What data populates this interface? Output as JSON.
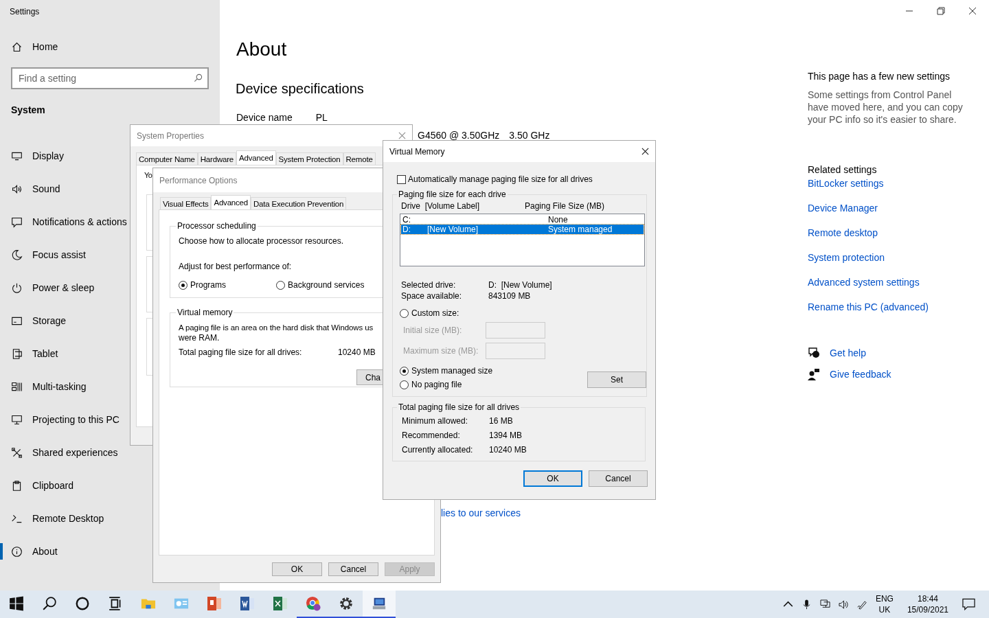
{
  "window": {
    "title": "Settings"
  },
  "sidebar": {
    "home": "Home",
    "search": {
      "placeholder": "Find a setting"
    },
    "section": "System",
    "items": [
      {
        "label": "Display",
        "kind": "display",
        "selected": false
      },
      {
        "label": "Sound",
        "kind": "sound",
        "selected": false
      },
      {
        "label": "Notifications & actions",
        "kind": "notifications",
        "selected": false
      },
      {
        "label": "Focus assist",
        "kind": "focus",
        "selected": false
      },
      {
        "label": "Power & sleep",
        "kind": "power",
        "selected": false
      },
      {
        "label": "Storage",
        "kind": "storage",
        "selected": false
      },
      {
        "label": "Tablet",
        "kind": "tablet",
        "selected": false
      },
      {
        "label": "Multi-tasking",
        "kind": "multitasking",
        "selected": false
      },
      {
        "label": "Projecting to this PC",
        "kind": "projecting",
        "selected": false
      },
      {
        "label": "Shared experiences",
        "kind": "shared",
        "selected": false
      },
      {
        "label": "Clipboard",
        "kind": "clipboard",
        "selected": false
      },
      {
        "label": "Remote Desktop",
        "kind": "remote",
        "selected": false
      },
      {
        "label": "About",
        "kind": "about",
        "selected": true
      }
    ]
  },
  "main": {
    "title": "About",
    "section": "Device specifications",
    "device_name_label": "Device name",
    "device_name": "PL",
    "processor_fragment": "G4560 @ 3.50GHz",
    "processor_speed": "3.50 GHz",
    "link_fragment": "lies to our services"
  },
  "aside": {
    "notice_title": "This page has a few new settings",
    "notice_text": "Some settings from Control Panel have moved here, and you can copy your PC info so it's easier to share.",
    "related_title": "Related settings",
    "links": [
      "BitLocker settings",
      "Device Manager",
      "Remote desktop",
      "System protection",
      "Advanced system settings",
      "Rename this PC (advanced)"
    ],
    "help": [
      {
        "label": "Get help",
        "kind": "help"
      },
      {
        "label": "Give feedback",
        "kind": "feedback"
      }
    ]
  },
  "system_properties": {
    "title": "System Properties",
    "tabs": [
      {
        "label": "Computer Name",
        "selected": false
      },
      {
        "label": "Hardware",
        "selected": false
      },
      {
        "label": "Advanced",
        "selected": true
      },
      {
        "label": "System Protection",
        "selected": false
      },
      {
        "label": "Remote",
        "selected": false
      }
    ],
    "fragment": "Yo"
  },
  "performance_options": {
    "title": "Performance Options",
    "tabs": [
      {
        "label": "Visual Effects",
        "selected": false
      },
      {
        "label": "Advanced",
        "selected": true
      },
      {
        "label": "Data Execution Prevention",
        "selected": false
      }
    ],
    "scheduling": {
      "legend": "Processor scheduling",
      "text": "Choose how to allocate processor resources.",
      "prompt": "Adjust for best performance of:",
      "options": [
        {
          "label": "Programs",
          "selected": true
        },
        {
          "label": "Background services",
          "selected": false
        }
      ]
    },
    "virtual_memory": {
      "legend": "Virtual memory",
      "line_1": "A paging file is an area on the hard disk that Windows us",
      "line_2": "were RAM.",
      "total_label": "Total paging file size for all drives:",
      "total_value": "10240 MB",
      "change_button": "Cha"
    },
    "buttons": [
      {
        "label": "OK",
        "disabled": false
      },
      {
        "label": "Cancel",
        "disabled": false
      },
      {
        "label": "Apply",
        "disabled": true
      }
    ]
  },
  "virtual_memory": {
    "title": "Virtual Memory",
    "auto_manage": {
      "label": "Automatically manage paging file size for all drives",
      "checked": false
    },
    "drives_legend": "Paging file size for each drive",
    "columns": [
      "Drive  [Volume Label]",
      "Paging File Size (MB)"
    ],
    "drives": [
      {
        "drive": "C:",
        "size": "None",
        "selected": false
      },
      {
        "drive": "D:",
        "label": "[New Volume]",
        "size": "System managed",
        "selected": true
      }
    ],
    "selected_drive_label": "Selected drive:",
    "selected_drive": "D:  [New Volume]",
    "space_label": "Space available:",
    "space": "843109 MB",
    "size_options": [
      {
        "label": "Custom size:",
        "selected": false
      },
      {
        "label": "System managed size",
        "selected": true
      },
      {
        "label": "No paging file",
        "selected": false
      }
    ],
    "fields": [
      {
        "label": "Initial size (MB):",
        "disabled": true
      },
      {
        "label": "Maximum size (MB):",
        "disabled": true
      }
    ],
    "set_button": "Set",
    "totals_legend": "Total paging file size for all drives",
    "totals": [
      {
        "label": "Minimum allowed:",
        "value": "16 MB"
      },
      {
        "label": "Recommended:",
        "value": "1394 MB"
      },
      {
        "label": "Currently allocated:",
        "value": "10240 MB"
      }
    ],
    "buttons": [
      {
        "label": "OK",
        "default": true
      },
      {
        "label": "Cancel",
        "default": false
      }
    ]
  },
  "taskbar": {
    "apps": [
      {
        "kind": "start",
        "running": false,
        "focused": false
      },
      {
        "kind": "search",
        "running": false,
        "focused": false
      },
      {
        "kind": "cortana",
        "running": false,
        "focused": false
      },
      {
        "kind": "taskview",
        "running": false,
        "focused": false
      },
      {
        "kind": "explorer",
        "running": false,
        "focused": false
      },
      {
        "kind": "controlpanel",
        "running": false,
        "focused": false
      },
      {
        "kind": "powerpoint",
        "running": false,
        "focused": false
      },
      {
        "kind": "word",
        "running": false,
        "focused": false
      },
      {
        "kind": "excel",
        "running": false,
        "focused": false
      },
      {
        "kind": "chrome",
        "running": true,
        "focused": false
      },
      {
        "kind": "settings",
        "running": true,
        "focused": false
      },
      {
        "kind": "sysprops",
        "running": true,
        "focused": true
      }
    ],
    "language": "ENG",
    "region": "UK",
    "time": "18:44",
    "date": "15/09/2021"
  }
}
